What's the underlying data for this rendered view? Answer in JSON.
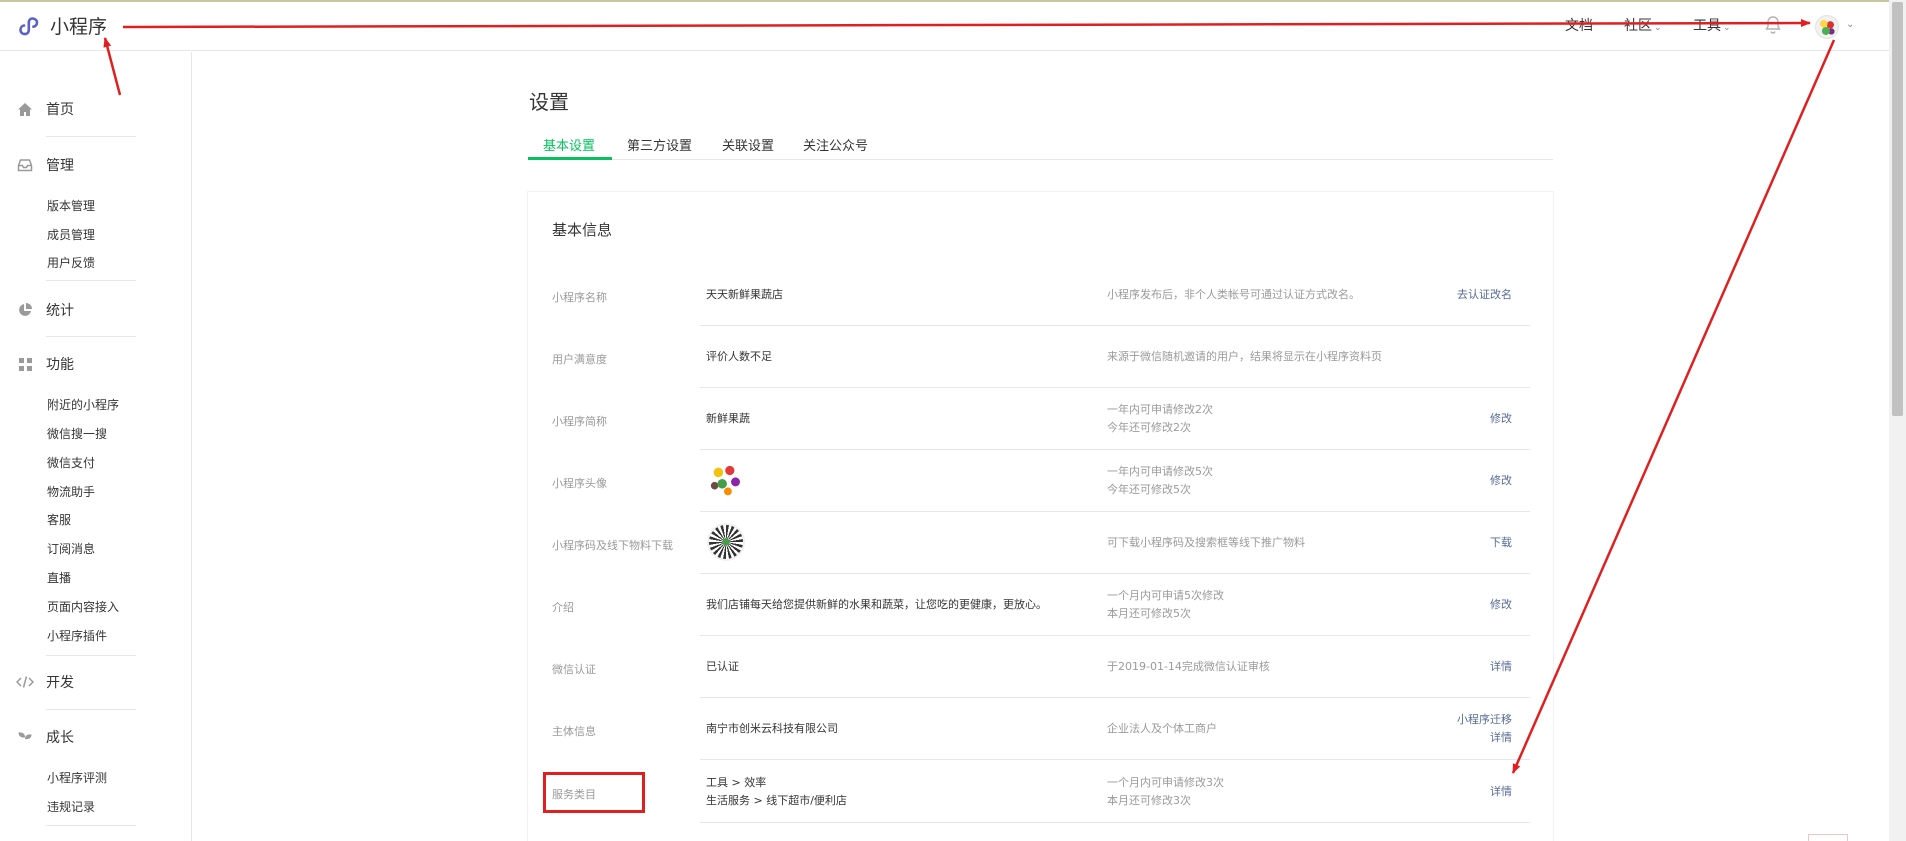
{
  "app": {
    "title": "小程序"
  },
  "topnav": {
    "docs": "文档",
    "community": "社区",
    "tools": "工具"
  },
  "sidebar": {
    "home": "首页",
    "manage": {
      "label": "管理",
      "items": [
        "版本管理",
        "成员管理",
        "用户反馈"
      ]
    },
    "stats": "统计",
    "features": {
      "label": "功能",
      "items": [
        "附近的小程序",
        "微信搜一搜",
        "微信支付",
        "物流助手",
        "客服",
        "订阅消息",
        "直播",
        "页面内容接入",
        "小程序插件"
      ]
    },
    "dev": "开发",
    "growth": {
      "label": "成长",
      "items": [
        "小程序评测",
        "违规记录"
      ]
    }
  },
  "page": {
    "title": "设置",
    "tabs": [
      "基本设置",
      "第三方设置",
      "关联设置",
      "关注公众号"
    ],
    "active_tab": 0
  },
  "basic_info": {
    "title": "基本信息",
    "rows": [
      {
        "label": "小程序名称",
        "value": "天天新鲜果蔬店",
        "tip": "小程序发布后，非个人类帐号可通过认证方式改名。",
        "action": "去认证改名"
      },
      {
        "label": "用户满意度",
        "value": "评价人数不足",
        "tip": "来源于微信随机邀请的用户，结果将显示在小程序资料页",
        "action": ""
      },
      {
        "label": "小程序简称",
        "value": "新鲜果蔬",
        "tip": "一年内可申请修改2次",
        "tip2": "今年还可修改2次",
        "action": "修改"
      },
      {
        "label": "小程序头像",
        "value": "",
        "image": "fruit-avatar-image",
        "tip": "一年内可申请修改5次",
        "tip2": "今年还可修改5次",
        "action": "修改"
      },
      {
        "label": "小程序码及线下物料下载",
        "value": "",
        "image": "qr-code-image",
        "tip": "可下载小程序码及搜索框等线下推广物料",
        "action": "下载"
      },
      {
        "label": "介绍",
        "value": "我们店铺每天给您提供新鲜的水果和蔬菜，让您吃的更健康，更放心。",
        "tip": "一个月内可申请5次修改",
        "tip2": "本月还可修改5次",
        "action": "修改"
      },
      {
        "label": "微信认证",
        "value": "已认证",
        "tip": "于2019-01-14完成微信认证审核",
        "action": "详情"
      },
      {
        "label": "主体信息",
        "value": "南宁市创米云科技有限公司",
        "tip": "企业法人及个体工商户",
        "action": "小程序迁移",
        "action2": "详情"
      },
      {
        "label": "服务类目",
        "value": "工具 > 效率",
        "value2": "生活服务 > 线下超市/便利店",
        "tip": "一个月内可申请修改3次",
        "tip2": "本月还可修改3次",
        "action": "详情"
      }
    ]
  },
  "colors": {
    "accent_green": "#07c160",
    "link_blue": "#576b95",
    "annotation_red": "#e02020"
  }
}
